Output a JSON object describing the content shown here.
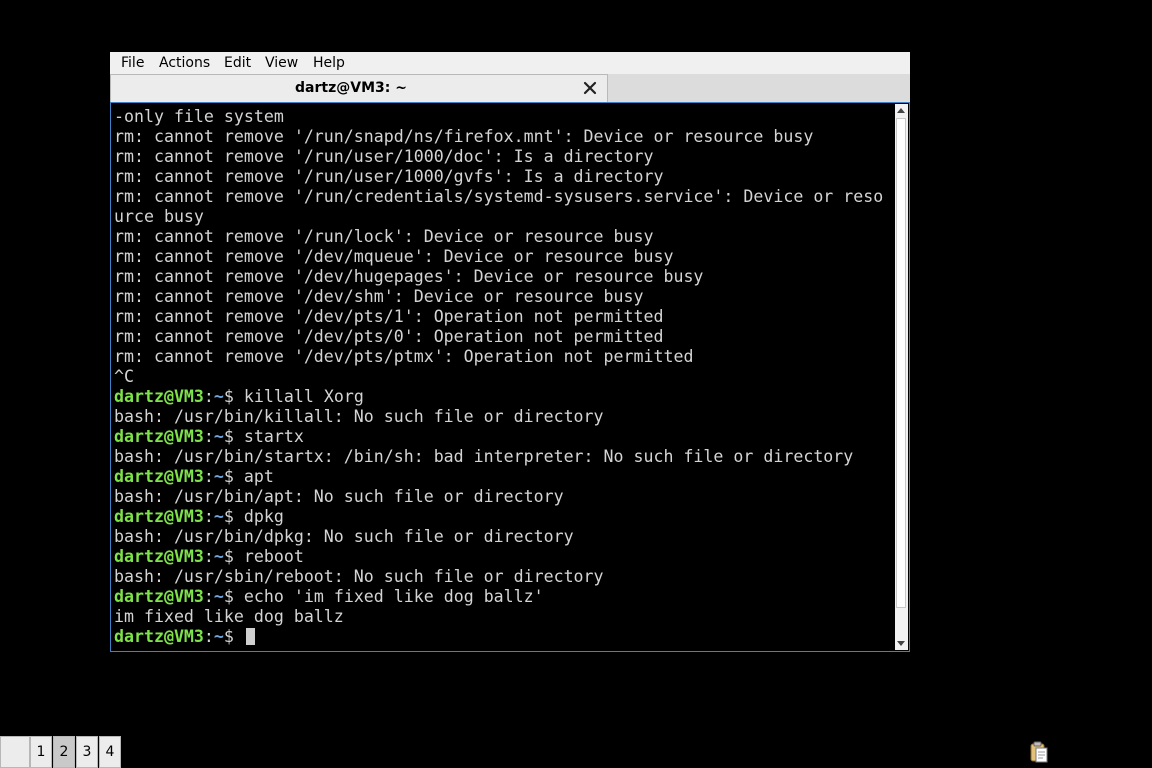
{
  "menu": [
    "File",
    "Actions",
    "Edit",
    "View",
    "Help"
  ],
  "tab": {
    "title": "dartz@VM3: ~",
    "close_icon": "close-icon"
  },
  "prompt": {
    "user": "dartz@VM3",
    "sep": ":",
    "path": "~",
    "sym": "$"
  },
  "terminal": {
    "lines": [
      {
        "text": "-only file system"
      },
      {
        "text": "rm: cannot remove '/run/snapd/ns/firefox.mnt': Device or resource busy"
      },
      {
        "text": "rm: cannot remove '/run/user/1000/doc': Is a directory"
      },
      {
        "text": "rm: cannot remove '/run/user/1000/gvfs': Is a directory"
      },
      {
        "text": "rm: cannot remove '/run/credentials/systemd-sysusers.service': Device or reso"
      },
      {
        "text": "urce busy"
      },
      {
        "text": "rm: cannot remove '/run/lock': Device or resource busy"
      },
      {
        "text": "rm: cannot remove '/dev/mqueue': Device or resource busy"
      },
      {
        "text": "rm: cannot remove '/dev/hugepages': Device or resource busy"
      },
      {
        "text": "rm: cannot remove '/dev/shm': Device or resource busy"
      },
      {
        "text": "rm: cannot remove '/dev/pts/1': Operation not permitted"
      },
      {
        "text": "rm: cannot remove '/dev/pts/0': Operation not permitted"
      },
      {
        "text": "rm: cannot remove '/dev/pts/ptmx': Operation not permitted"
      },
      {
        "text": "^C"
      },
      {
        "cmd": "killall Xorg"
      },
      {
        "text": "bash: /usr/bin/killall: No such file or directory"
      },
      {
        "cmd": "startx"
      },
      {
        "text": "bash: /usr/bin/startx: /bin/sh: bad interpreter: No such file or directory"
      },
      {
        "cmd": "apt"
      },
      {
        "text": "bash: /usr/bin/apt: No such file or directory"
      },
      {
        "cmd": "dpkg"
      },
      {
        "text": "bash: /usr/bin/dpkg: No such file or directory"
      },
      {
        "cmd": "reboot"
      },
      {
        "text": "bash: /usr/sbin/reboot: No such file or directory"
      },
      {
        "cmd": "echo 'im fixed like dog ballz'"
      },
      {
        "text": "im fixed like dog ballz"
      },
      {
        "cmd": "",
        "cursor": true
      }
    ]
  },
  "taskbar": {
    "desktops": [
      "1",
      "2",
      "3",
      "4"
    ],
    "active_desktop": "2"
  },
  "colors": {
    "prompt_user": "#7ee34a",
    "prompt_path": "#6fa7e0",
    "terminal_bg": "#000000",
    "terminal_fg": "#d4d4d4",
    "focus_border": "#3d82c4"
  },
  "icons": {
    "tray": "clipboard-icon",
    "close": "close-icon",
    "scroll_up": "arrow-up-icon",
    "scroll_down": "arrow-down-icon"
  }
}
